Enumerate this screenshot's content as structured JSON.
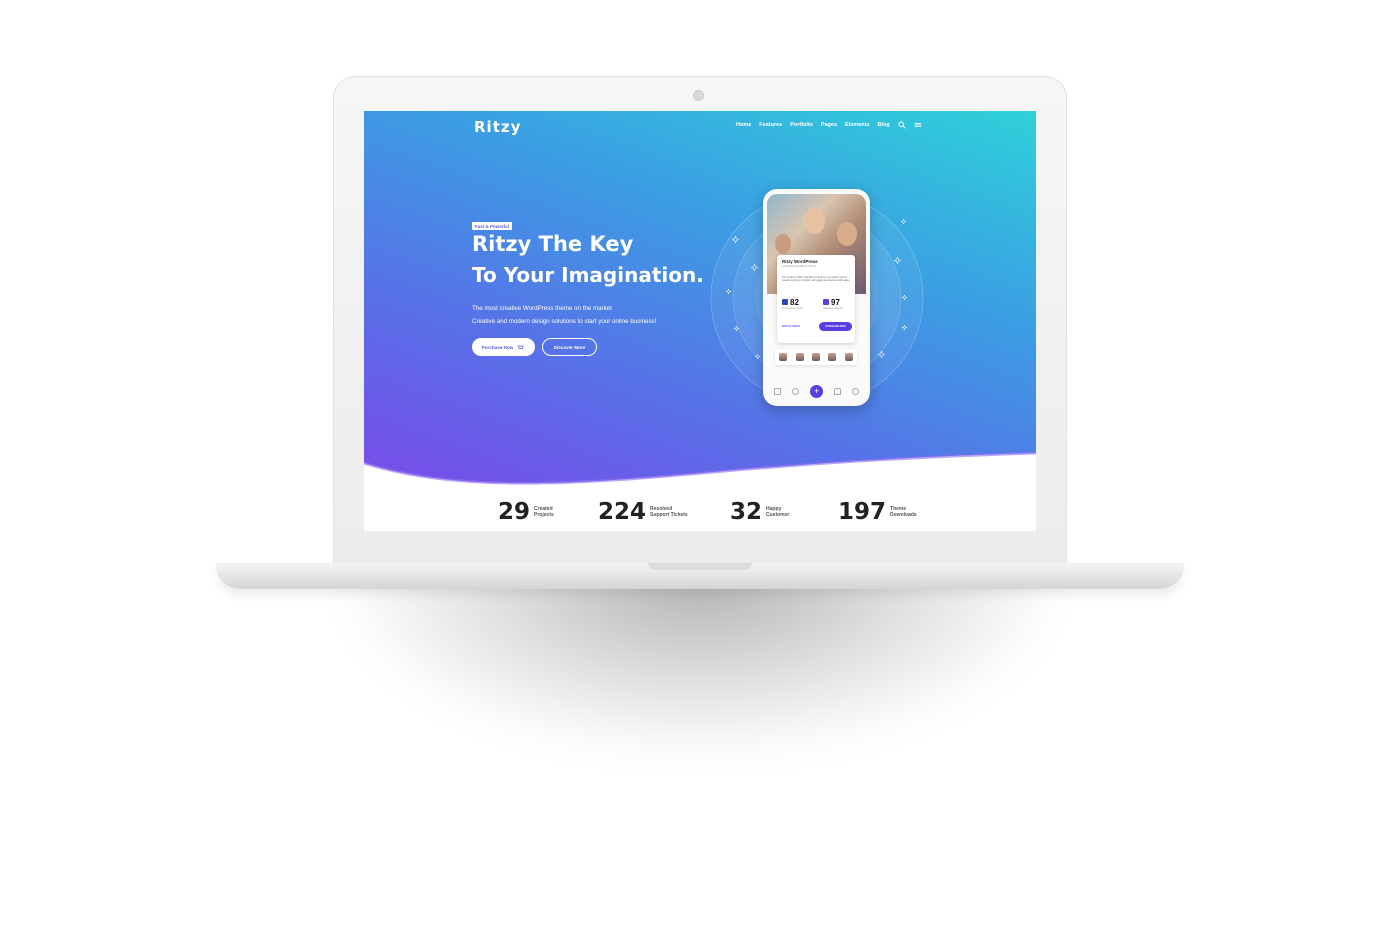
{
  "brand": {
    "logo": "Ritzy"
  },
  "nav": {
    "items": [
      "Home",
      "Features",
      "Portfolio",
      "Pages",
      "Elements",
      "Blog"
    ],
    "search_icon": "search-icon",
    "menu_icon": "hamburger-menu-icon"
  },
  "hero": {
    "badge": "Fast & Powerful",
    "title_line1": "Ritzy The Key",
    "title_line2": "To Your Imagination.",
    "subtitle_line1": "The most creative WordPress theme on the market",
    "subtitle_line2": "Creative and modern design solutions to start your online business!",
    "primary_button": "Purchase Now",
    "secondary_button": "Discover More"
  },
  "phone_card": {
    "title": "Ritzy WordPress",
    "meta": "● Creative WordPress Theme",
    "description": "The smart ex Ritzy WordPress theme is a modern tool to create stunning & stylish web pages and layouts with ease.",
    "stat1_value": "82",
    "stat1_label": "Professional Layouts",
    "stat2_value": "97",
    "stat2_label": "Satisfied Customers",
    "link": "WATCH VIDEO",
    "button": "PURCHASE NOW"
  },
  "stats": [
    {
      "number": "29",
      "label_line1": "Created",
      "label_line2": "Projects"
    },
    {
      "number": "224",
      "label_line1": "Resolved",
      "label_line2": "Support Tickets"
    },
    {
      "number": "32",
      "label_line1": "Happy",
      "label_line2": "Customer"
    },
    {
      "number": "197",
      "label_line1": "Theme",
      "label_line2": "Downloads"
    }
  ],
  "colors": {
    "gradient_top": "#2fd1da",
    "gradient_bottom": "#7b4ae9",
    "accent": "#5b3de6"
  }
}
